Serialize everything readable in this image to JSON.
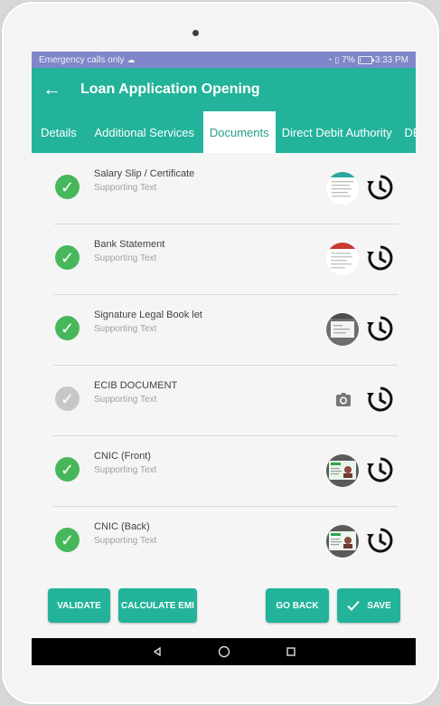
{
  "status": {
    "left_text": "Emergency calls only",
    "signal_icon": "cloud-sync-icon",
    "battery_percent": "7%",
    "battery_level": 0.07,
    "time": "3:33 PM"
  },
  "appbar": {
    "back_icon": "arrow-left-icon",
    "title": "Loan Application Opening"
  },
  "tabs": [
    {
      "label": "Details"
    },
    {
      "label": "Additional Services"
    },
    {
      "label": "Documents"
    },
    {
      "label": "Direct Debit Authority"
    },
    {
      "label": "DBR"
    }
  ],
  "documents": [
    {
      "title": "Salary Slip / Certificate",
      "subtitle": "Supporting Text",
      "status": "complete",
      "thumb": "document-thumbnail-icon"
    },
    {
      "title": "Bank Statement",
      "subtitle": "Supporting Text",
      "status": "complete",
      "thumb": "document-thumbnail-icon"
    },
    {
      "title": "Signature Legal Book let",
      "subtitle": "Supporting Text",
      "status": "complete",
      "thumb": "document-thumbnail-icon"
    },
    {
      "title": "ECIB DOCUMENT",
      "subtitle": "Supporting Text",
      "status": "pending",
      "thumb": "camera-icon"
    },
    {
      "title": "CNIC (Front)",
      "subtitle": "Supporting Text",
      "status": "complete",
      "thumb": "id-card-thumbnail-icon"
    },
    {
      "title": "CNIC (Back)",
      "subtitle": "Supporting Text",
      "status": "complete",
      "thumb": "id-card-thumbnail-icon"
    }
  ],
  "actions": {
    "validate": "VALIDATE",
    "calculate_emi": "CALCULATE EMI",
    "go_back": "GO BACK",
    "save": "SAVE"
  },
  "colors": {
    "primary": "#22b39a",
    "status_bar": "#7f86c9",
    "check_green": "#47b75b",
    "check_gray": "#c7c7c7"
  }
}
